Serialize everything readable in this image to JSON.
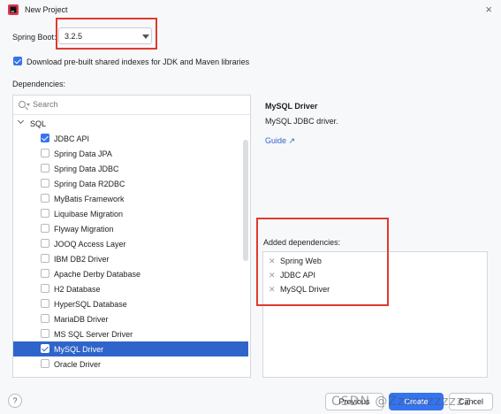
{
  "window": {
    "title": "New Project"
  },
  "spring_boot": {
    "label": "Spring Boot:",
    "version": "3.2.5"
  },
  "download_indexes": {
    "label": "Download pre-built shared indexes for JDK and Maven libraries",
    "checked": true
  },
  "dependencies": {
    "label": "Dependencies:",
    "search_placeholder": "Search",
    "group": "SQL",
    "items": [
      {
        "label": "JDBC API",
        "checked": true
      },
      {
        "label": "Spring Data JPA",
        "checked": false
      },
      {
        "label": "Spring Data JDBC",
        "checked": false
      },
      {
        "label": "Spring Data R2DBC",
        "checked": false
      },
      {
        "label": "MyBatis Framework",
        "checked": false
      },
      {
        "label": "Liquibase Migration",
        "checked": false
      },
      {
        "label": "Flyway Migration",
        "checked": false
      },
      {
        "label": "JOOQ Access Layer",
        "checked": false
      },
      {
        "label": "IBM DB2 Driver",
        "checked": false
      },
      {
        "label": "Apache Derby Database",
        "checked": false
      },
      {
        "label": "H2 Database",
        "checked": false
      },
      {
        "label": "HyperSQL Database",
        "checked": false
      },
      {
        "label": "MariaDB Driver",
        "checked": false
      },
      {
        "label": "MS SQL Server Driver",
        "checked": false
      },
      {
        "label": "MySQL Driver",
        "checked": true,
        "selected": true
      },
      {
        "label": "Oracle Driver",
        "checked": false
      }
    ]
  },
  "info": {
    "name": "MySQL Driver",
    "description": "MySQL JDBC driver.",
    "guide": "Guide ↗"
  },
  "added": {
    "label": "Added dependencies:",
    "items": [
      "Spring Web",
      "JDBC API",
      "MySQL Driver"
    ]
  },
  "buttons": {
    "help": "?",
    "previous": "Previous",
    "create": "Create",
    "cancel": "Cancel"
  },
  "watermark": "CSDN @Zzzzzzzzzzz-",
  "colors": {
    "accent": "#3574f0",
    "selection": "#2f65ca",
    "highlight": "#e03a2e"
  }
}
